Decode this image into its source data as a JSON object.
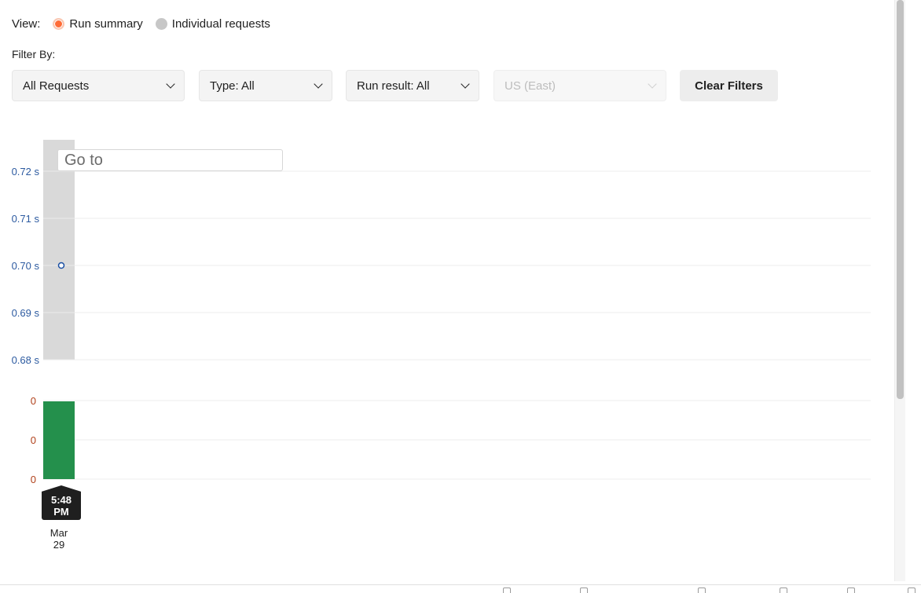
{
  "view": {
    "label": "View:",
    "options": [
      {
        "label": "Run summary",
        "selected": true
      },
      {
        "label": "Individual requests",
        "selected": false
      }
    ]
  },
  "filters": {
    "label": "Filter By:",
    "requests": "All Requests",
    "type": "Type: All",
    "run_result": "Run result: All",
    "region": "US (East)",
    "clear_label": "Clear Filters"
  },
  "goto": {
    "placeholder": "Go to"
  },
  "chart_data": {
    "type": "bar",
    "response_time_axis": {
      "ticks": [
        "0.72 s",
        "0.71 s",
        "0.70 s",
        "0.69 s",
        "0.68 s"
      ],
      "tick_values": [
        0.72,
        0.71,
        0.7,
        0.69,
        0.68
      ],
      "ylim": [
        0.675,
        0.726
      ]
    },
    "count_axis": {
      "ticks": [
        "0",
        "0",
        "0"
      ]
    },
    "points": [
      {
        "time": "5:48 PM",
        "date": "Mar 29",
        "response_time": 0.7,
        "result": "passed"
      }
    ],
    "colors": {
      "avg_marker": "#1a4fa3",
      "highlight": "#d9d9d9",
      "passed_bar": "#24904c",
      "time_axis": "#2c5aa0",
      "count_axis": "#b0401a"
    }
  },
  "x_label": {
    "time": "5:48 PM",
    "time_line1": "5:48",
    "time_line2": "PM",
    "date_line1": "Mar",
    "date_line2": "29"
  }
}
